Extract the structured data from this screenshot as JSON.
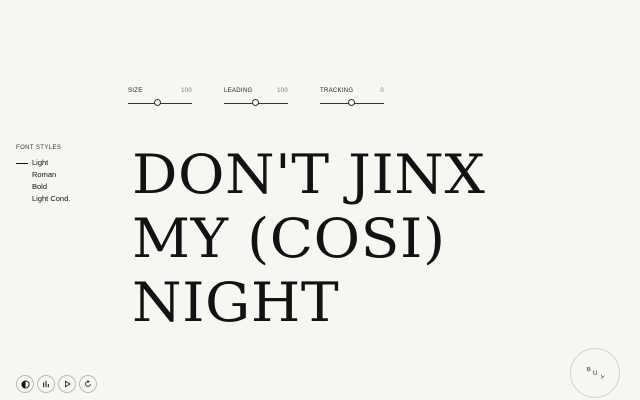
{
  "sliders": [
    {
      "label": "SIZE",
      "value": "100",
      "position": 0.45
    },
    {
      "label": "LEADING",
      "value": "100",
      "position": 0.45
    },
    {
      "label": "TRACKING",
      "value": "0",
      "position": 0.45
    }
  ],
  "font_styles": {
    "title": "FONT STYLES",
    "items": [
      "Light",
      "Roman",
      "Bold",
      "Light Cond."
    ],
    "selected": "Light"
  },
  "specimen": {
    "lines": [
      "DON'T JINX",
      "MY (COSI)",
      "NIGHT"
    ]
  },
  "controls": [
    {
      "icon": "contrast-icon"
    },
    {
      "icon": "bar-chart-icon"
    },
    {
      "icon": "play-icon"
    },
    {
      "icon": "refresh-icon"
    }
  ],
  "buy": {
    "letters": [
      "B",
      "U",
      "Y"
    ]
  }
}
